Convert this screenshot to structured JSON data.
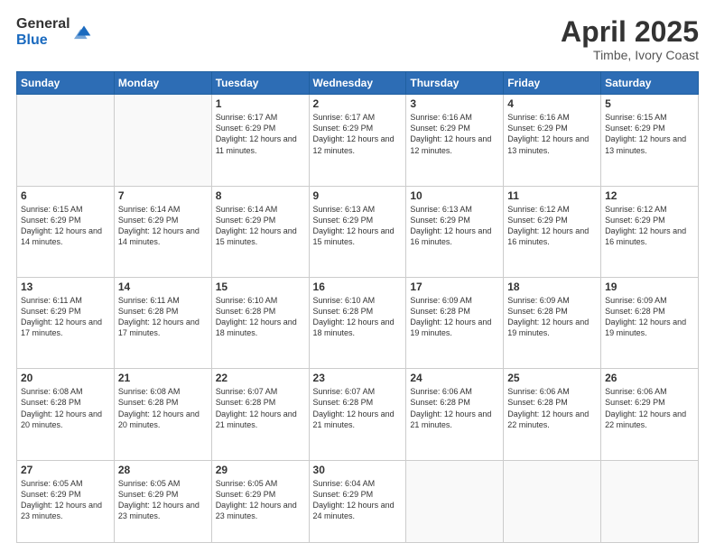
{
  "logo": {
    "general": "General",
    "blue": "Blue"
  },
  "title": "April 2025",
  "subtitle": "Timbe, Ivory Coast",
  "days_of_week": [
    "Sunday",
    "Monday",
    "Tuesday",
    "Wednesday",
    "Thursday",
    "Friday",
    "Saturday"
  ],
  "weeks": [
    [
      {
        "day": "",
        "info": ""
      },
      {
        "day": "",
        "info": ""
      },
      {
        "day": "1",
        "info": "Sunrise: 6:17 AM\nSunset: 6:29 PM\nDaylight: 12 hours and 11 minutes."
      },
      {
        "day": "2",
        "info": "Sunrise: 6:17 AM\nSunset: 6:29 PM\nDaylight: 12 hours and 12 minutes."
      },
      {
        "day": "3",
        "info": "Sunrise: 6:16 AM\nSunset: 6:29 PM\nDaylight: 12 hours and 12 minutes."
      },
      {
        "day": "4",
        "info": "Sunrise: 6:16 AM\nSunset: 6:29 PM\nDaylight: 12 hours and 13 minutes."
      },
      {
        "day": "5",
        "info": "Sunrise: 6:15 AM\nSunset: 6:29 PM\nDaylight: 12 hours and 13 minutes."
      }
    ],
    [
      {
        "day": "6",
        "info": "Sunrise: 6:15 AM\nSunset: 6:29 PM\nDaylight: 12 hours and 14 minutes."
      },
      {
        "day": "7",
        "info": "Sunrise: 6:14 AM\nSunset: 6:29 PM\nDaylight: 12 hours and 14 minutes."
      },
      {
        "day": "8",
        "info": "Sunrise: 6:14 AM\nSunset: 6:29 PM\nDaylight: 12 hours and 15 minutes."
      },
      {
        "day": "9",
        "info": "Sunrise: 6:13 AM\nSunset: 6:29 PM\nDaylight: 12 hours and 15 minutes."
      },
      {
        "day": "10",
        "info": "Sunrise: 6:13 AM\nSunset: 6:29 PM\nDaylight: 12 hours and 16 minutes."
      },
      {
        "day": "11",
        "info": "Sunrise: 6:12 AM\nSunset: 6:29 PM\nDaylight: 12 hours and 16 minutes."
      },
      {
        "day": "12",
        "info": "Sunrise: 6:12 AM\nSunset: 6:29 PM\nDaylight: 12 hours and 16 minutes."
      }
    ],
    [
      {
        "day": "13",
        "info": "Sunrise: 6:11 AM\nSunset: 6:29 PM\nDaylight: 12 hours and 17 minutes."
      },
      {
        "day": "14",
        "info": "Sunrise: 6:11 AM\nSunset: 6:28 PM\nDaylight: 12 hours and 17 minutes."
      },
      {
        "day": "15",
        "info": "Sunrise: 6:10 AM\nSunset: 6:28 PM\nDaylight: 12 hours and 18 minutes."
      },
      {
        "day": "16",
        "info": "Sunrise: 6:10 AM\nSunset: 6:28 PM\nDaylight: 12 hours and 18 minutes."
      },
      {
        "day": "17",
        "info": "Sunrise: 6:09 AM\nSunset: 6:28 PM\nDaylight: 12 hours and 19 minutes."
      },
      {
        "day": "18",
        "info": "Sunrise: 6:09 AM\nSunset: 6:28 PM\nDaylight: 12 hours and 19 minutes."
      },
      {
        "day": "19",
        "info": "Sunrise: 6:09 AM\nSunset: 6:28 PM\nDaylight: 12 hours and 19 minutes."
      }
    ],
    [
      {
        "day": "20",
        "info": "Sunrise: 6:08 AM\nSunset: 6:28 PM\nDaylight: 12 hours and 20 minutes."
      },
      {
        "day": "21",
        "info": "Sunrise: 6:08 AM\nSunset: 6:28 PM\nDaylight: 12 hours and 20 minutes."
      },
      {
        "day": "22",
        "info": "Sunrise: 6:07 AM\nSunset: 6:28 PM\nDaylight: 12 hours and 21 minutes."
      },
      {
        "day": "23",
        "info": "Sunrise: 6:07 AM\nSunset: 6:28 PM\nDaylight: 12 hours and 21 minutes."
      },
      {
        "day": "24",
        "info": "Sunrise: 6:06 AM\nSunset: 6:28 PM\nDaylight: 12 hours and 21 minutes."
      },
      {
        "day": "25",
        "info": "Sunrise: 6:06 AM\nSunset: 6:28 PM\nDaylight: 12 hours and 22 minutes."
      },
      {
        "day": "26",
        "info": "Sunrise: 6:06 AM\nSunset: 6:29 PM\nDaylight: 12 hours and 22 minutes."
      }
    ],
    [
      {
        "day": "27",
        "info": "Sunrise: 6:05 AM\nSunset: 6:29 PM\nDaylight: 12 hours and 23 minutes."
      },
      {
        "day": "28",
        "info": "Sunrise: 6:05 AM\nSunset: 6:29 PM\nDaylight: 12 hours and 23 minutes."
      },
      {
        "day": "29",
        "info": "Sunrise: 6:05 AM\nSunset: 6:29 PM\nDaylight: 12 hours and 23 minutes."
      },
      {
        "day": "30",
        "info": "Sunrise: 6:04 AM\nSunset: 6:29 PM\nDaylight: 12 hours and 24 minutes."
      },
      {
        "day": "",
        "info": ""
      },
      {
        "day": "",
        "info": ""
      },
      {
        "day": "",
        "info": ""
      }
    ]
  ]
}
